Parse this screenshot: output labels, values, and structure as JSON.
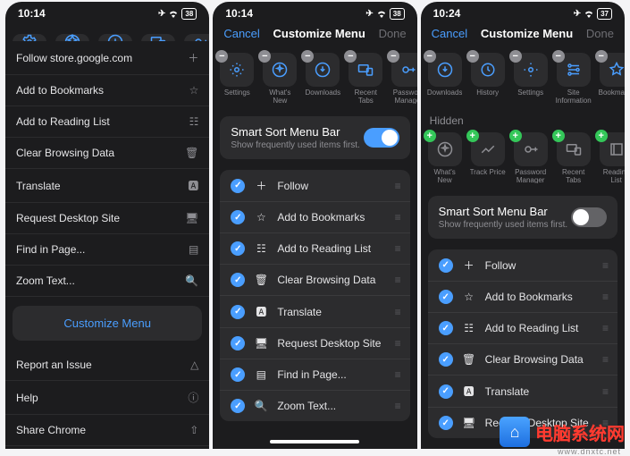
{
  "status": {
    "time1": "10:14",
    "time2": "10:14",
    "time3": "10:24",
    "batt1": "38",
    "batt2": "38",
    "batt3": "37"
  },
  "modal": {
    "cancel": "Cancel",
    "title": "Customize Menu",
    "done": "Done"
  },
  "hstrip1": [
    {
      "label": "Settings",
      "icon": "gear"
    },
    {
      "label": "What's New",
      "icon": "sparkle"
    },
    {
      "label": "Downloads",
      "icon": "download"
    },
    {
      "label": "Recent Tabs",
      "icon": "devices"
    },
    {
      "label": "Password Manager",
      "icon": "key"
    }
  ],
  "hstrip2": [
    {
      "label": "Settings",
      "icon": "gear"
    },
    {
      "label": "What's New",
      "icon": "sparkle"
    },
    {
      "label": "Downloads",
      "icon": "download"
    },
    {
      "label": "Recent Tabs",
      "icon": "devices"
    },
    {
      "label": "Password Manager",
      "icon": "key"
    }
  ],
  "hstrip3a": [
    {
      "label": "Downloads",
      "icon": "download"
    },
    {
      "label": "History",
      "icon": "history"
    },
    {
      "label": "Settings",
      "icon": "gear"
    },
    {
      "label": "Site Information",
      "icon": "info"
    },
    {
      "label": "Bookmarks",
      "icon": "star"
    }
  ],
  "hidden_label": "Hidden",
  "hstrip3b": [
    {
      "label": "What's New",
      "icon": "sparkle"
    },
    {
      "label": "Track Price",
      "icon": "trend"
    },
    {
      "label": "Password Manager",
      "icon": "key"
    },
    {
      "label": "Recent Tabs",
      "icon": "devices"
    },
    {
      "label": "Reading List",
      "icon": "readlist"
    }
  ],
  "smart": {
    "title": "Smart Sort Menu Bar",
    "subtitle": "Show frequently used items first."
  },
  "menu1": [
    {
      "label": "Follow store.google.com",
      "trail": "plus"
    },
    {
      "label": "Add to Bookmarks",
      "trail": "star"
    },
    {
      "label": "Add to Reading List",
      "trail": "readlist"
    },
    {
      "label": "Clear Browsing Data",
      "trail": "trash"
    },
    {
      "label": "Translate",
      "trail": "translate"
    },
    {
      "label": "Request Desktop Site",
      "trail": "desktop"
    },
    {
      "label": "Find in Page...",
      "trail": "find"
    },
    {
      "label": "Zoom Text...",
      "trail": "zoom"
    }
  ],
  "customize_btn": "Customize Menu",
  "footer": [
    {
      "label": "Report an Issue",
      "trail": "warn"
    },
    {
      "label": "Help",
      "trail": "help"
    },
    {
      "label": "Share Chrome",
      "trail": "share"
    }
  ],
  "reorder": [
    {
      "label": "Follow",
      "icon": "plus"
    },
    {
      "label": "Add to Bookmarks",
      "icon": "star"
    },
    {
      "label": "Add to Reading List",
      "icon": "readlist"
    },
    {
      "label": "Clear Browsing Data",
      "icon": "trash"
    },
    {
      "label": "Translate",
      "icon": "translate"
    },
    {
      "label": "Request Desktop Site",
      "icon": "desktop"
    },
    {
      "label": "Find in Page...",
      "icon": "find"
    },
    {
      "label": "Zoom Text...",
      "icon": "zoom"
    }
  ],
  "reorder3": [
    {
      "label": "Follow",
      "icon": "plus"
    },
    {
      "label": "Add to Bookmarks",
      "icon": "star"
    },
    {
      "label": "Add to Reading List",
      "icon": "readlist"
    },
    {
      "label": "Clear Browsing Data",
      "icon": "trash"
    },
    {
      "label": "Translate",
      "icon": "translate"
    },
    {
      "label": "Request Desktop Site",
      "icon": "desktop"
    }
  ],
  "watermark": {
    "text": "电脑系统网",
    "sub": "www.dnxtc.net"
  }
}
